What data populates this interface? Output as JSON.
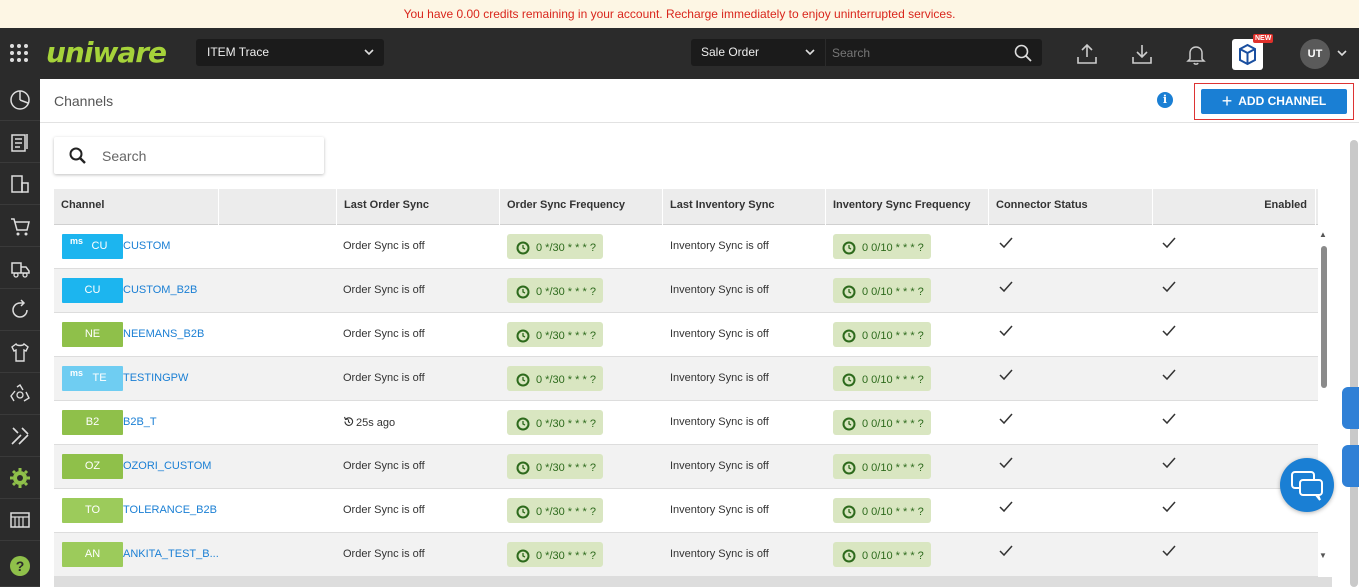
{
  "banner": {
    "text": "You have 0.00 credits remaining in your account. Recharge immediately to enjoy uninterrupted services."
  },
  "topbar": {
    "logo_text": "uniware",
    "facility_select": "ITEM Trace",
    "search_scope": "Sale Order",
    "search_placeholder": "Search",
    "new_badge": "NEW",
    "user_initials": "UT"
  },
  "sidebar": {
    "items": [
      {
        "name": "dashboard-icon"
      },
      {
        "name": "orders-icon"
      },
      {
        "name": "procurement-icon"
      },
      {
        "name": "cart-icon"
      },
      {
        "name": "shipping-icon"
      },
      {
        "name": "returns-icon"
      },
      {
        "name": "products-icon"
      },
      {
        "name": "recycle-icon"
      },
      {
        "name": "tools-icon"
      },
      {
        "name": "settings-icon"
      },
      {
        "name": "reports-icon"
      },
      {
        "name": "help-icon"
      }
    ]
  },
  "page": {
    "title": "Channels",
    "add_button": "ADD CHANNEL",
    "table_search_placeholder": "Search"
  },
  "table": {
    "headers": [
      "Channel",
      "",
      "Last Order Sync",
      "Order Sync Frequency",
      "Last Inventory Sync",
      "Inventory Sync Frequency",
      "Connector Status",
      "Enabled"
    ],
    "rows": [
      {
        "badge": "CU",
        "ms": "ms",
        "badge_color": "#1cb5ef",
        "name": "CUSTOM",
        "last_order": "Order Sync is off",
        "order_freq": "0 */30 * * * ?",
        "last_inv": "Inventory Sync is off",
        "inv_freq": "0 0/10 * * * ?"
      },
      {
        "badge": "CU",
        "ms": "",
        "badge_color": "#1cb5ef",
        "name": "CUSTOM_B2B",
        "last_order": "Order Sync is off",
        "order_freq": "0 */30 * * * ?",
        "last_inv": "Inventory Sync is off",
        "inv_freq": "0 0/10 * * * ?"
      },
      {
        "badge": "NE",
        "ms": "",
        "badge_color": "#8fc04a",
        "name": "NEEMANS_B2B",
        "last_order": "Order Sync is off",
        "order_freq": "0 */30 * * * ?",
        "last_inv": "Inventory Sync is off",
        "inv_freq": "0 0/10 * * * ?"
      },
      {
        "badge": "TE",
        "ms": "ms",
        "badge_color": "#6fcdf2",
        "name": "TESTINGPW",
        "last_order": "Order Sync is off",
        "order_freq": "0 */30 * * * ?",
        "last_inv": "Inventory Sync is off",
        "inv_freq": "0 0/10 * * * ?"
      },
      {
        "badge": "B2",
        "ms": "",
        "badge_color": "#8fc04a",
        "name": "B2B_T",
        "last_order": "25s ago",
        "order_freq": "0 */30 * * * ?",
        "last_inv": "Inventory Sync is off",
        "inv_freq": "0 0/10 * * * ?"
      },
      {
        "badge": "OZ",
        "ms": "",
        "badge_color": "#8fc04a",
        "name": "OZORI_CUSTOM",
        "last_order": "Order Sync is off",
        "order_freq": "0 */30 * * * ?",
        "last_inv": "Inventory Sync is off",
        "inv_freq": "0 0/10 * * * ?"
      },
      {
        "badge": "TO",
        "ms": "",
        "badge_color": "#9ccb5b",
        "name": "TOLERANCE_B2B",
        "last_order": "Order Sync is off",
        "order_freq": "0 */30 * * * ?",
        "last_inv": "Inventory Sync is off",
        "inv_freq": "0 0/10 * * * ?"
      },
      {
        "badge": "AN",
        "ms": "",
        "badge_color": "#9ccb5b",
        "name": "ANKITA_TEST_B...",
        "last_order": "Order Sync is off",
        "order_freq": "0 */30 * * * ?",
        "last_inv": "Inventory Sync is off",
        "inv_freq": "0 0/10 * * * ?"
      }
    ]
  }
}
